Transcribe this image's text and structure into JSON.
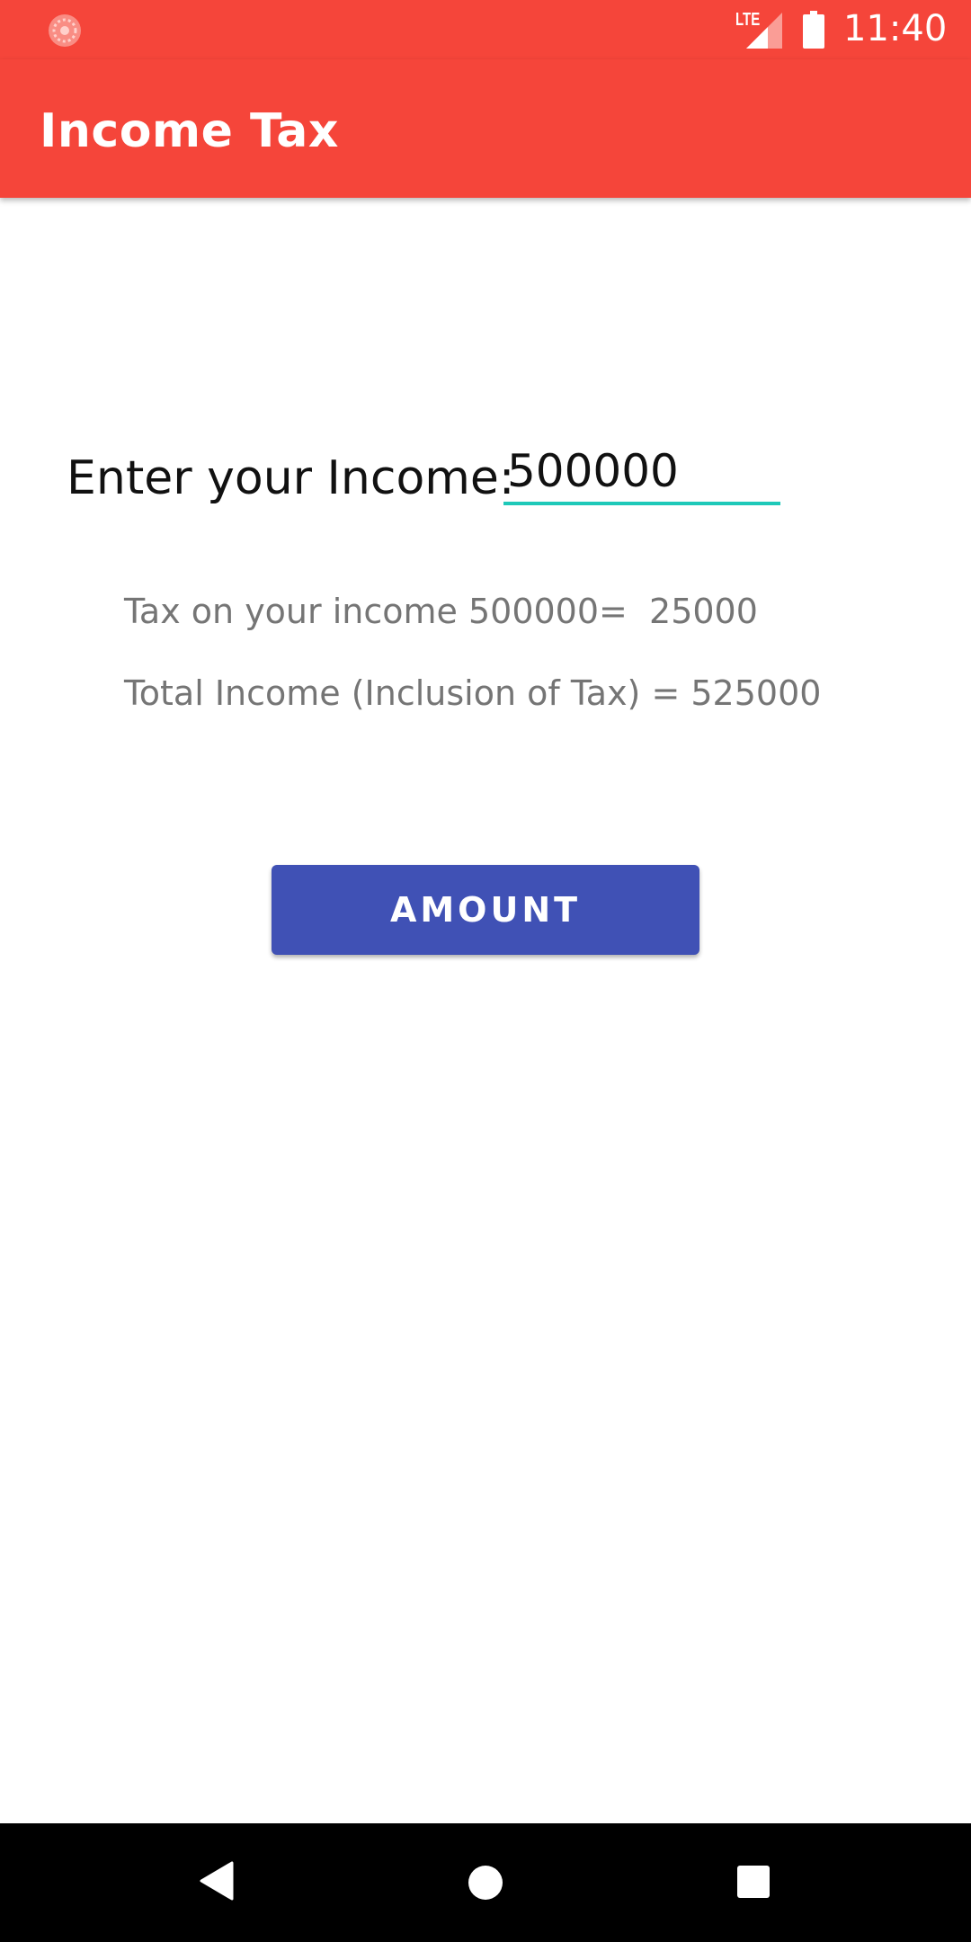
{
  "status_bar": {
    "time": "11:40",
    "network": "LTE",
    "icons": [
      "notification-icon",
      "signal-icon",
      "battery-icon"
    ]
  },
  "app_bar": {
    "title": "Income Tax",
    "color": "#f5453a"
  },
  "form": {
    "income_label": "Enter your Income:",
    "income_value": "500000",
    "underline_color": "#1ec9b9"
  },
  "results": {
    "tax_line": "Tax on your income 500000=  25000",
    "total_line": "Total Income (Inclusion of Tax) = 525000"
  },
  "button": {
    "label": "AMOUNT",
    "color": "#4051b5"
  },
  "nav_bar": {
    "icons": [
      "back-icon",
      "home-icon",
      "recents-icon"
    ]
  }
}
